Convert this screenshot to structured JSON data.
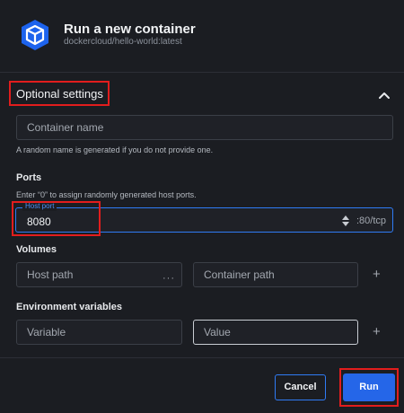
{
  "header": {
    "title": "Run a new container",
    "image": "dockercloud/hello-world:latest",
    "logo_icon": "container-box-icon"
  },
  "optional_settings": {
    "title": "Optional settings",
    "collapse_icon": "chevron-up-icon"
  },
  "container_name": {
    "placeholder": "Container name",
    "help": "A random name is generated if you do not provide one."
  },
  "ports": {
    "label": "Ports",
    "help": "Enter “0” to assign randomly generated host ports.",
    "host_port_label": "Host port",
    "host_port_value": "8080",
    "container_port": ":80/tcp"
  },
  "volumes": {
    "label": "Volumes",
    "host_path_placeholder": "Host path",
    "browse": "···",
    "container_path_placeholder": "Container path",
    "add": "+"
  },
  "env": {
    "label": "Environment variables",
    "variable_placeholder": "Variable",
    "value_placeholder": "Value",
    "add": "+"
  },
  "actions": {
    "cancel": "Cancel",
    "run": "Run"
  },
  "colors": {
    "background": "#1b1d22",
    "accent": "#2566e8",
    "focus_border": "#2f7bf5",
    "highlight": "#e21d1d"
  }
}
